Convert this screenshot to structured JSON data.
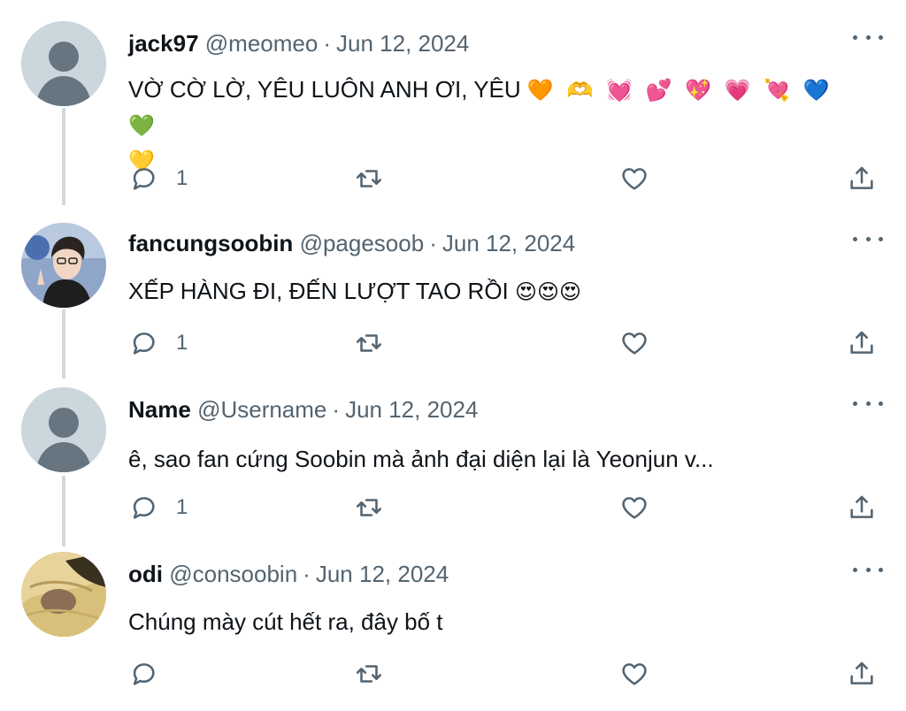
{
  "tweets": [
    {
      "name": "jack97",
      "handle": "@meomeo",
      "date": "Jun 12, 2024",
      "text": "VỜ CỜ LỜ, YÊU LUÔN ANH ƠI, YÊU",
      "emoji_line1": "🧡 🫶 💓 💕 💖 💗 💘 💙 💚",
      "emoji_line2": "💛",
      "reply_count": "1",
      "avatar": "default-avatar"
    },
    {
      "name": "fancungsoobin",
      "handle": "@pagesoob",
      "date": "Jun 12, 2024",
      "text": "XẾP HÀNG ĐI, ĐẾN LƯỢT TAO RỒI",
      "emoji_line1": "😍😍😍",
      "reply_count": "1",
      "avatar": "photo-avatar"
    },
    {
      "name": "Name",
      "handle": "@Username",
      "date": "Jun 12, 2024",
      "text": "ê, sao fan cứng Soobin mà ảnh đại diện lại là Yeonjun v...",
      "reply_count": "1",
      "avatar": "default-avatar"
    },
    {
      "name": "odi",
      "handle": "@consoobin",
      "date": "Jun 12, 2024",
      "text": "Chúng mày cút hết ra, đây bố t",
      "reply_count": "",
      "avatar": "photo-avatar"
    }
  ],
  "separator": "·",
  "icons": [
    "reply-icon",
    "retweet-icon",
    "like-icon",
    "share-icon",
    "more-icon"
  ],
  "colors": {
    "text": "#0f1419",
    "secondary": "#536471",
    "thread_line": "#cfd9de",
    "avatar_bg": "#ccd6dd"
  }
}
